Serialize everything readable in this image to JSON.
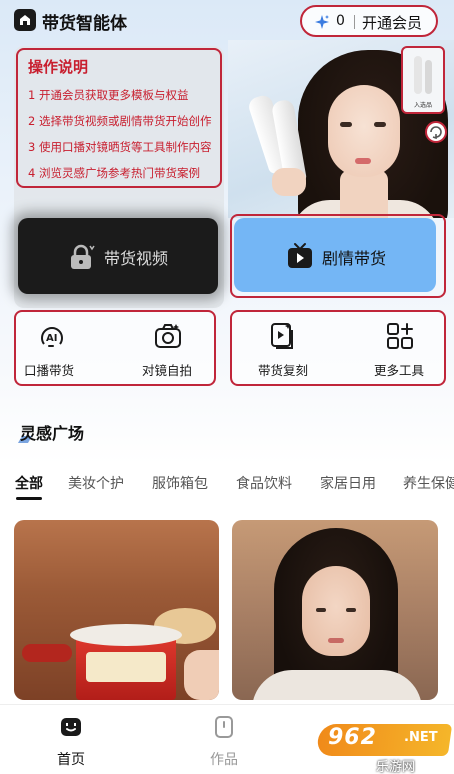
{
  "header": {
    "app_title": "带货智能体",
    "coins": "0",
    "vip_label": "开通会员"
  },
  "hero": {
    "product_thumb_label": "入选品"
  },
  "instructions": {
    "title": "操作说明",
    "lines": [
      "1 开通会员获取更多模板与权益",
      "2 选择带货视频或剧情带货开始创作",
      "3 使用口播对镜晒货等工具制作内容",
      "4 浏览灵感广场参考热门带货案例"
    ]
  },
  "main_actions": {
    "video_label": "带货视频",
    "drama_label": "剧情带货"
  },
  "tools": [
    {
      "label": "口播带货",
      "icon": "ai-voice-icon"
    },
    {
      "label": "对镜自拍",
      "icon": "camera-icon"
    },
    {
      "label": "带货复刻",
      "icon": "video-copy-icon"
    },
    {
      "label": "更多工具",
      "icon": "more-tools-icon"
    }
  ],
  "inspiration": {
    "title": "灵感广场",
    "tabs": [
      "全部",
      "美妆个护",
      "服饰箱包",
      "食品饮料",
      "家居日用",
      "养生保健"
    ],
    "active_tab": "全部"
  },
  "bottom_nav": {
    "items": [
      {
        "label": "首页",
        "icon": "home-icon",
        "active": true
      },
      {
        "label": "作品",
        "icon": "works-icon",
        "active": false
      }
    ]
  },
  "watermark": {
    "main": "962",
    "net": ".NET",
    "sub": "乐游网"
  },
  "colors": {
    "accent_red": "#c0263a",
    "primary_blue": "#74b6f5",
    "dark_button": "#1b1b1b",
    "instruction_text": "#c81e2e"
  }
}
